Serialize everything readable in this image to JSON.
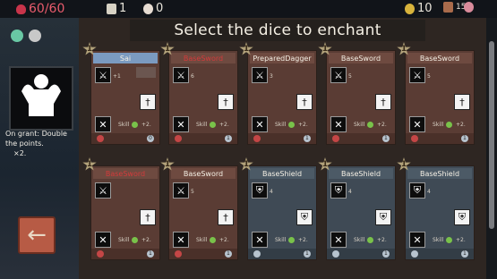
{
  "top": {
    "hp": "60/60",
    "cards": "1",
    "skull": "0",
    "coins": "10",
    "level": "15"
  },
  "left": {
    "grant_text": "On grant: Double the points.",
    "grant_mod": "×2."
  },
  "title": "Select the dice to enchant",
  "icons": {
    "dice": "dice-icon",
    "card": "card-icon",
    "skull": "skull-icon",
    "coin": "coin-icon",
    "cog": "gear-icon",
    "back": "arrow-left-icon"
  },
  "cards": [
    {
      "name": "Sai",
      "badge": "1",
      "type": "sword",
      "top_value": "+1",
      "skill": "Skill",
      "mult": "+2.",
      "n": "0"
    },
    {
      "name": "BaseSword",
      "badge": "1",
      "type": "sword",
      "top_value": "6",
      "skill": "Skill",
      "mult": "+2.",
      "n": "1"
    },
    {
      "name": "PreparedDagger",
      "badge": "1",
      "type": "sword",
      "top_value": "3",
      "skill": "Skill",
      "mult": "+2.",
      "n": "1"
    },
    {
      "name": "BaseSword",
      "badge": "1",
      "type": "sword",
      "top_value": "5",
      "skill": "Skill",
      "mult": "+2.",
      "n": "1"
    },
    {
      "name": "BaseSword",
      "badge": "1",
      "type": "sword",
      "top_value": "5",
      "skill": "Skill",
      "mult": "+2.",
      "n": "1"
    },
    {
      "name": "BaseSword",
      "badge": "1",
      "type": "sword",
      "top_value": "",
      "skill": "Skill",
      "mult": "+2.",
      "n": "1"
    },
    {
      "name": "BaseSword",
      "badge": "1",
      "type": "sword",
      "top_value": "5",
      "skill": "Skill",
      "mult": "+2.",
      "n": "1"
    },
    {
      "name": "BaseShield",
      "badge": "1",
      "type": "shield",
      "top_value": "4",
      "skill": "Skill",
      "mult": "+2.",
      "n": "1"
    },
    {
      "name": "BaseShield",
      "badge": "1",
      "type": "shield",
      "top_value": "4",
      "skill": "Skill",
      "mult": "+2.",
      "n": "1"
    },
    {
      "name": "BaseShield",
      "badge": "1",
      "type": "shield",
      "top_value": "4",
      "skill": "Skill",
      "mult": "+2.",
      "n": "1"
    }
  ]
}
